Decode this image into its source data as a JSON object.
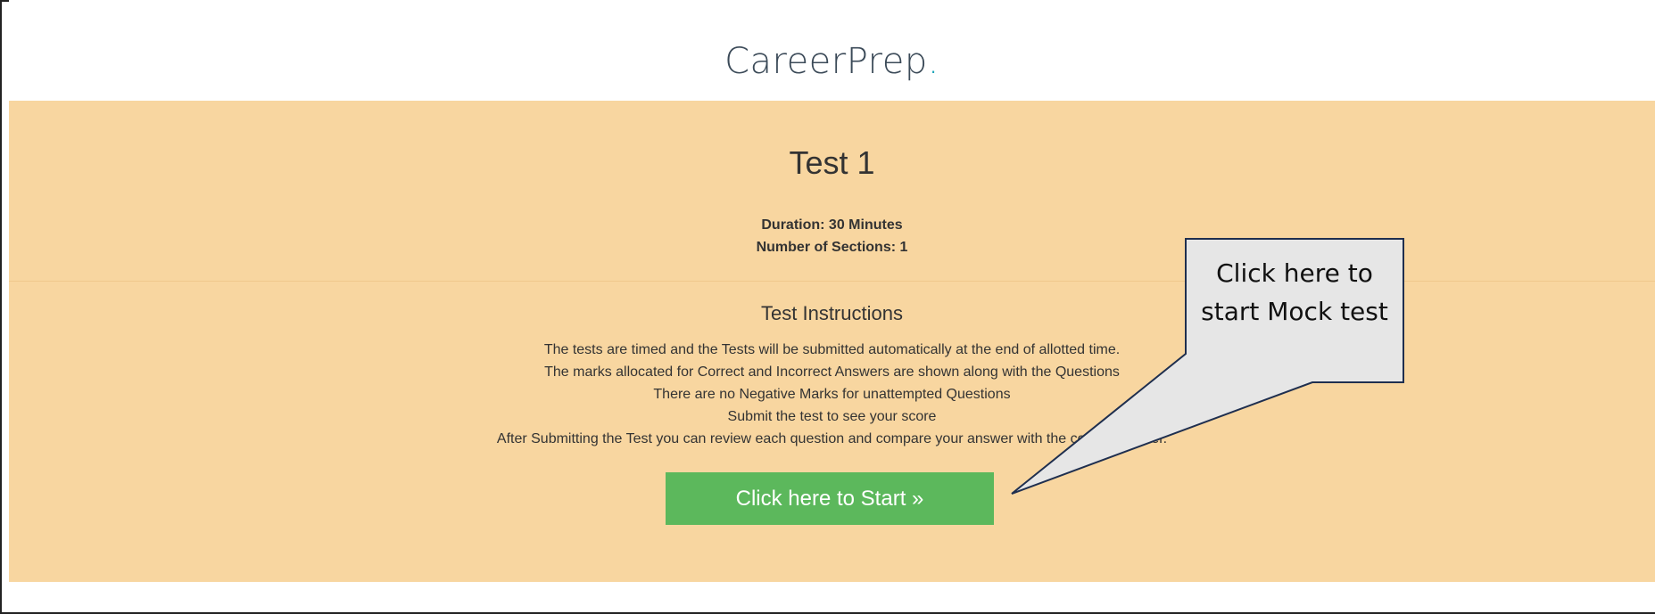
{
  "header": {
    "logo_text": "CareerPrep",
    "logo_dot": "."
  },
  "test": {
    "title": "Test 1",
    "duration": "Duration: 30 Minutes",
    "sections": "Number of Sections: 1"
  },
  "instructions": {
    "title": "Test Instructions",
    "lines": [
      "The tests are timed and the Tests will be submitted automatically at the end of allotted time.",
      "The marks allocated for Correct and Incorrect Answers are shown along with the Questions",
      "There are no Negative Marks for unattempted Questions",
      "Submit the test to see your score",
      "After Submitting the Test you can review each question and compare your answer with the correct answer."
    ]
  },
  "start_button": {
    "label": "Click here to Start »"
  },
  "callout": {
    "text": "Click here to start Mock test"
  },
  "colors": {
    "band": "#f8d6a0",
    "button": "#5cb85c",
    "logo_accent": "#1aa3b8",
    "callout_fill": "#e6e6e6"
  }
}
